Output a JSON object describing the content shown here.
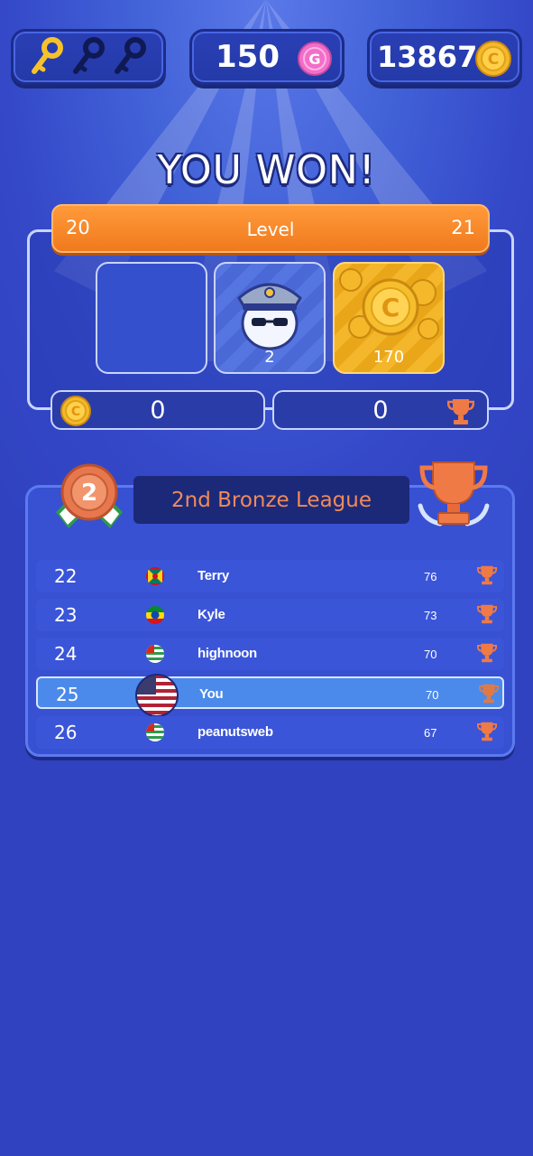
{
  "topbar": {
    "keys_owned": 1,
    "keys_total": 3,
    "gems": "150",
    "coins": "13867"
  },
  "title": "YOU WON!",
  "level": {
    "label": "Level",
    "current": "20",
    "next": "21",
    "progress": 1.0
  },
  "rewards": {
    "avatar_count": "2",
    "coin_reward": "170"
  },
  "counters": {
    "coins": "0",
    "trophies": "0"
  },
  "league": {
    "name": "2nd Bronze League",
    "medal_number": "2",
    "rows": [
      {
        "rank": "22",
        "name": "Terry",
        "score": "76",
        "flag": "grenada-flag"
      },
      {
        "rank": "23",
        "name": "Kyle",
        "score": "73",
        "flag": "ethiopia-flag"
      },
      {
        "rank": "24",
        "name": "highnoon",
        "score": "70",
        "flag": "abkhazia-flag"
      },
      {
        "rank": "25",
        "name": "You",
        "score": "70",
        "flag": "usa-flag"
      },
      {
        "rank": "26",
        "name": "peanutsweb",
        "score": "67",
        "flag": "abkhazia-flag"
      }
    ]
  },
  "colors": {
    "background": "#3042c0",
    "level_bar": "#f58a2a",
    "league_text": "#f08a5a",
    "highlight_row": "#4b8aea",
    "trophy": "#f07a45"
  }
}
